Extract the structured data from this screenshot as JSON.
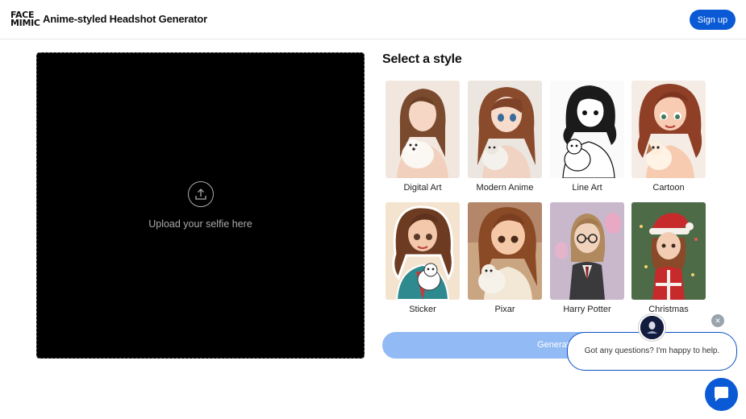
{
  "header": {
    "logo_line1": "FACE",
    "logo_line2": "MIMIC",
    "title": "Anime-styled Headshot Generator",
    "signup_label": "Sign up"
  },
  "upload": {
    "text": "Upload your selfie here",
    "icon": "upload-icon"
  },
  "styles": {
    "heading": "Select a style",
    "items": [
      {
        "label": "Digital Art"
      },
      {
        "label": "Modern Anime"
      },
      {
        "label": "Line Art"
      },
      {
        "label": "Cartoon"
      },
      {
        "label": "Sticker"
      },
      {
        "label": "Pixar"
      },
      {
        "label": "Harry Potter"
      },
      {
        "label": "Christmas"
      }
    ]
  },
  "generate_label": "Generate",
  "chat": {
    "message": "Got any questions? I'm happy to help.",
    "close_icon": "close-icon",
    "launcher_icon": "chat-icon"
  },
  "colors": {
    "accent": "#0a5ad6",
    "generate_disabled": "#92baf4"
  }
}
